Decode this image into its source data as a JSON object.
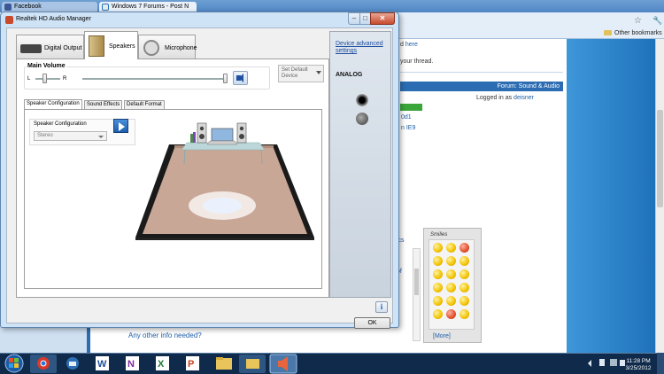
{
  "browser": {
    "tabs": [
      {
        "label": "Facebook"
      },
      {
        "label": "Windows 7 Forums - Post N"
      }
    ],
    "bookmarks_label": "Other bookmarks",
    "page": {
      "here_prefix": "d",
      "here_link": "here",
      "thread_text": "your thread.",
      "forum_label": "Forum: Sound & Audio",
      "logged_in_prefix": "Logged in as",
      "logged_in_user": "deisner",
      "link_1": "0d1",
      "link_2": "n IE9",
      "peek_ics": "ics",
      "peek_of": "of",
      "any_info": "Any other info needed?",
      "smilies_title": "Smilies",
      "smilies_more": "[More]"
    }
  },
  "dialog": {
    "title": "Realtek HD Audio Manager",
    "device_tabs": [
      {
        "label": "Digital Output"
      },
      {
        "label": "Speakers"
      },
      {
        "label": "Microphone"
      }
    ],
    "main_volume": {
      "label": "Main Volume",
      "left_label": "L",
      "right_label": "R",
      "level": 1.0,
      "balance": 0.35
    },
    "set_default_label": "Set Default Device",
    "sub_tabs": [
      {
        "label": "Speaker Configuration"
      },
      {
        "label": "Sound Effects"
      },
      {
        "label": "Default Format"
      }
    ],
    "speaker_config": {
      "group_label": "Speaker Configuration",
      "selected": "Stereo"
    },
    "advanced_link": "Device advanced settings",
    "analog_label": "ANALOG",
    "info_label": "i",
    "ok_label": "OK"
  },
  "taskbar": {
    "time": "11:28 PM",
    "date": "3/25/2012"
  },
  "colors": {
    "accent": "#2b6cb2",
    "taskbar": "#0f2a4a",
    "floor": "#c9a796"
  }
}
